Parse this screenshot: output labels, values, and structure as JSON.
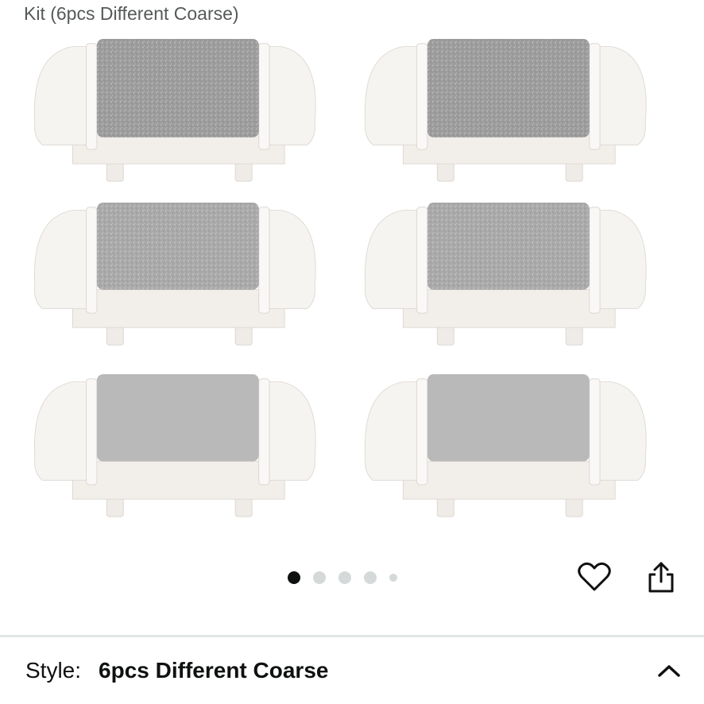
{
  "product": {
    "title_fragment": "Kit (6pcs Different Coarse)"
  },
  "gallery": {
    "image_count": 5,
    "active_index": 0,
    "item_description": "white roller refill heads with grey abrasive surface"
  },
  "actions": {
    "favorite_icon": "heart-icon",
    "share_icon": "share-icon"
  },
  "style_selector": {
    "label": "Style:",
    "value": "6pcs Different Coarse",
    "toggle_icon": "chevron-up-icon"
  },
  "colors": {
    "roller_body": "#f4f1ee",
    "abrasive_coarse": "#9c9c9c",
    "abrasive_medium": "#a9a9a9",
    "abrasive_fine": "#b9b9b9",
    "dot_active": "#0f1111",
    "dot_inactive": "#d5d9d9"
  }
}
